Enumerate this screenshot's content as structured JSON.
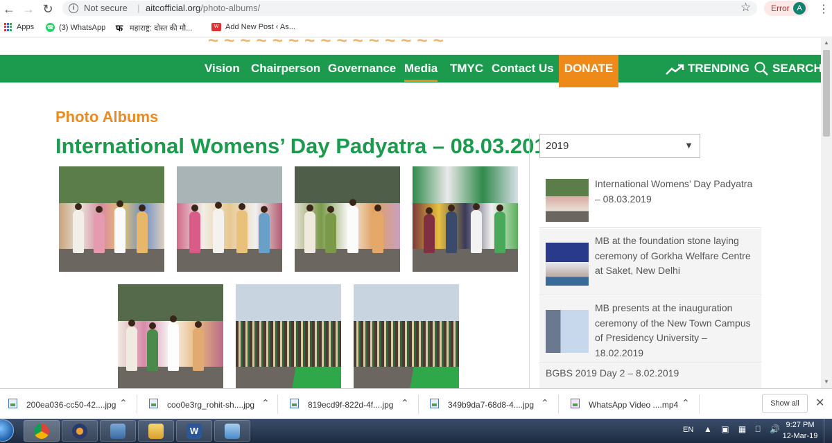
{
  "browser": {
    "url_security": "Not secure",
    "url_host": "aitcofficial.org",
    "url_path": "/photo-albums/",
    "status_chip": "Error",
    "profile_initial": "A"
  },
  "bookmarks": [
    {
      "label": "Apps",
      "icon": "apps-grid-icon"
    },
    {
      "label": "(3) WhatsApp",
      "icon": "whatsapp-icon"
    },
    {
      "label": "महाराष्ट्र: दोस्त की मौ...",
      "icon": "site-fa-icon"
    },
    {
      "label": "Add New Post ‹ As...",
      "icon": "wordpress-icon"
    }
  ],
  "site": {
    "nav": {
      "items": [
        "Vision",
        "Chairperson",
        "Governance",
        "Media",
        "TMYC",
        "Contact Us"
      ],
      "active": "Media",
      "donate": "DONATE",
      "trending": "TRENDING",
      "search": "SEARCH"
    },
    "section_label": "Photo Albums",
    "album_title": "International Womens’ Day Padyatra – 08.03.2019",
    "year_select": {
      "value": "2019"
    },
    "sidebar_albums": [
      "International Womens’ Day Padyatra – 08.03.2019",
      "MB at the foundation stone laying ceremony of Gorkha Welfare Centre at Saket, New Delhi",
      "MB presents at the inauguration ceremony of the New Town Campus of Presidency University – 18.02.2019",
      "BGBS 2019 Day 2 – 8.02.2019"
    ],
    "photo_count": 7
  },
  "downloads": {
    "items": [
      "200ea036-cc50-42....jpg",
      "coo0e3rg_rohit-sh....jpg",
      "819ecd9f-822d-4f....jpg",
      "349b9da7-68d8-4....jpg",
      "WhatsApp Video ....mp4"
    ],
    "show_all": "Show all"
  },
  "taskbar": {
    "language": "EN",
    "time": "9:27 PM",
    "date": "12-Mar-19",
    "apps": [
      "chrome-icon",
      "media-player-icon",
      "network-icon",
      "explorer-icon",
      "word-icon",
      "photo-viewer-icon"
    ]
  },
  "colors": {
    "nav_green": "#1c9a4e",
    "accent_orange": "#ee8a1a",
    "title_green": "#1c9a4e",
    "label_orange": "#ea8a22"
  }
}
